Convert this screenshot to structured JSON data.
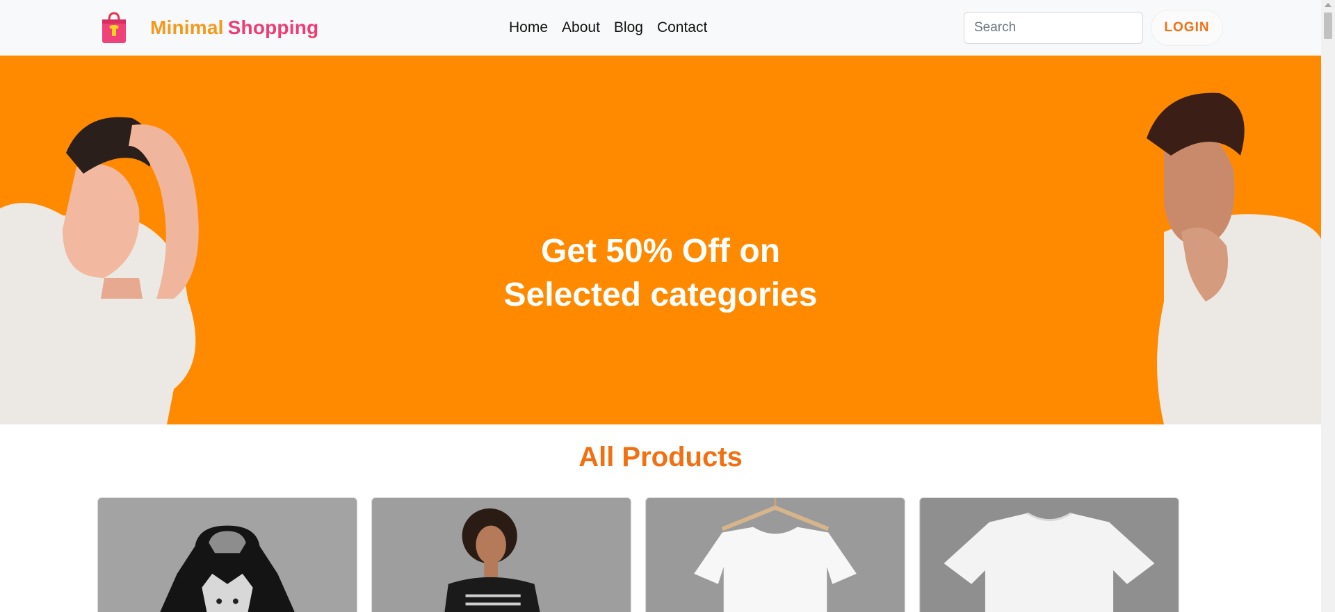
{
  "brand": {
    "name_part1": "Minimal",
    "name_part2": "Shopping",
    "icon": "shopping-bag-icon"
  },
  "nav": {
    "links": [
      "Home",
      "About",
      "Blog",
      "Contact"
    ]
  },
  "search": {
    "placeholder": "Search"
  },
  "login": {
    "label": "LOGIN"
  },
  "hero": {
    "line1": "Get 50% Off on",
    "line2": "Selected categories"
  },
  "products": {
    "title": "All Products",
    "items": [
      {
        "image": "black-hoodie-wolf-print"
      },
      {
        "image": "woman-black-tshirt"
      },
      {
        "image": "white-tshirt-on-hanger"
      },
      {
        "image": "white-tshirt-flat"
      }
    ]
  },
  "colors": {
    "accent": "#f07012",
    "hero_bg": "#ff8a00",
    "brand_pink": "#ef3c73",
    "brand_orange": "#f39a1c"
  }
}
